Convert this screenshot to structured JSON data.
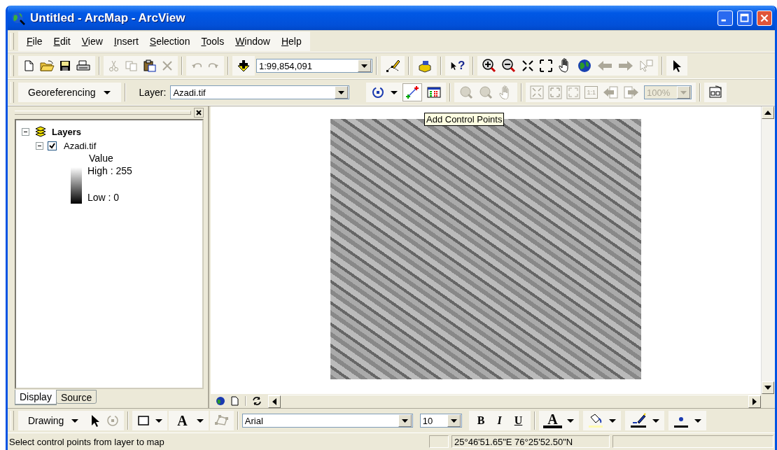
{
  "window": {
    "title": "Untitled - ArcMap - ArcView"
  },
  "menu": [
    {
      "label": "File"
    },
    {
      "label": "Edit"
    },
    {
      "label": "View"
    },
    {
      "label": "Insert"
    },
    {
      "label": "Selection"
    },
    {
      "label": "Tools"
    },
    {
      "label": "Window"
    },
    {
      "label": "Help"
    }
  ],
  "standard_toolbar": {
    "scale": "1:99,854,091",
    "whats_this": "?"
  },
  "georeferencing_toolbar": {
    "menu": "Georeferencing",
    "layer_label": "Layer:",
    "layer": "Azadi.tif",
    "fixed_zoom": "1:1",
    "zoom": "100%",
    "zoom_disabled": true
  },
  "tooltip": "Add Control Points",
  "toc": {
    "label": "Layers",
    "expanded": true,
    "children": [
      {
        "label": "Azadi.tif",
        "checked": true,
        "expanded": true,
        "legend": {
          "title": "Value",
          "high": "High : 255",
          "low": "Low : 0"
        }
      }
    ]
  },
  "toc_tabs": [
    {
      "label": "Display",
      "selected": true
    },
    {
      "label": "Source",
      "selected": false
    }
  ],
  "drawing_toolbar": {
    "menu": "Drawing",
    "text_tool": "A",
    "font": "Arial",
    "size": "10",
    "bold": "B",
    "italic": "I",
    "underline": "U",
    "font_color": "A"
  },
  "status_bar": {
    "message": "Select control points from layer to map",
    "coordinates": "25°46'51.65\"E  76°25'52.50\"N"
  }
}
